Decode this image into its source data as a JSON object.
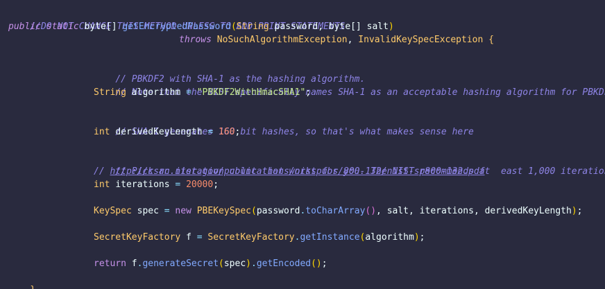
{
  "code": {
    "header_comment": "//DO NOT CHANGE THIS METHOD UNLESS TO ADD PRINT STATEMENTS",
    "sig": {
      "public": "public",
      "static": "static",
      "ret_type": "byte[]",
      "method": "getEncryptedPassword",
      "paren_open": "(",
      "p1_type": "String",
      "p1_name": "password",
      "comma1": ",",
      "p2_type": "byte[]",
      "p2_name": "salt",
      "paren_close": ")"
    },
    "throws": {
      "kw": "throws",
      "e1": "NoSuchAlgorithmException",
      "comma": ",",
      "e2": "InvalidKeySpecException",
      "brace": "{"
    },
    "c1": "// PBKDF2 with SHA-1 as the hashing algorithm.",
    "c2": "// Note that the NIST specifically names SHA-1 as an acceptable hashing algorithm for PBKDF2",
    "alg": {
      "type": "String",
      "name": "algorithm",
      "eq": "=",
      "value": "\"PBKDF2WithHmacSHA1\"",
      "semi": ";"
    },
    "c3": "// SHA-1 generates 160 bit hashes, so that's what makes sense here",
    "dkl": {
      "type": "int",
      "name": "derivedKeyLength",
      "eq": "=",
      "value": "160",
      "semi": ";"
    },
    "c4": "// Pick an iteration count that works for you. The NIST recommends at  east 1,000 iterations:",
    "c5_prefix": "// ",
    "c5_link": "http://csrc.nist.gov/publications/nistpubs/800-132/nist-sp800-132.pdf",
    "iter": {
      "type": "int",
      "name": "iterations",
      "eq": "=",
      "value": "20000",
      "semi": ";"
    },
    "spec": {
      "type": "KeySpec",
      "name": "spec",
      "eq": "=",
      "new": "new",
      "ctor": "PBEKeySpec",
      "po": "(",
      "a1": "password",
      "dot": ".",
      "m": "toCharArray",
      "mp": "()",
      "c1": ",",
      "a2": "salt",
      "c2": ",",
      "a3": "iterations",
      "c3": ",",
      "a4": "derivedKeyLength",
      "pc": ")",
      "semi": ";"
    },
    "skf": {
      "type": "SecretKeyFactory",
      "name": "f",
      "eq": "=",
      "cls": "SecretKeyFactory",
      "dot": ".",
      "m": "getInstance",
      "po": "(",
      "arg": "algorithm",
      "pc": ")",
      "semi": ";"
    },
    "ret": {
      "kw": "return",
      "obj": "f",
      "dot1": ".",
      "m1": "generateSecret",
      "po": "(",
      "arg": "spec",
      "pc": ")",
      "dot2": ".",
      "m2": "getEncoded",
      "mp": "()",
      "semi": ";"
    },
    "close_brace": "}"
  }
}
